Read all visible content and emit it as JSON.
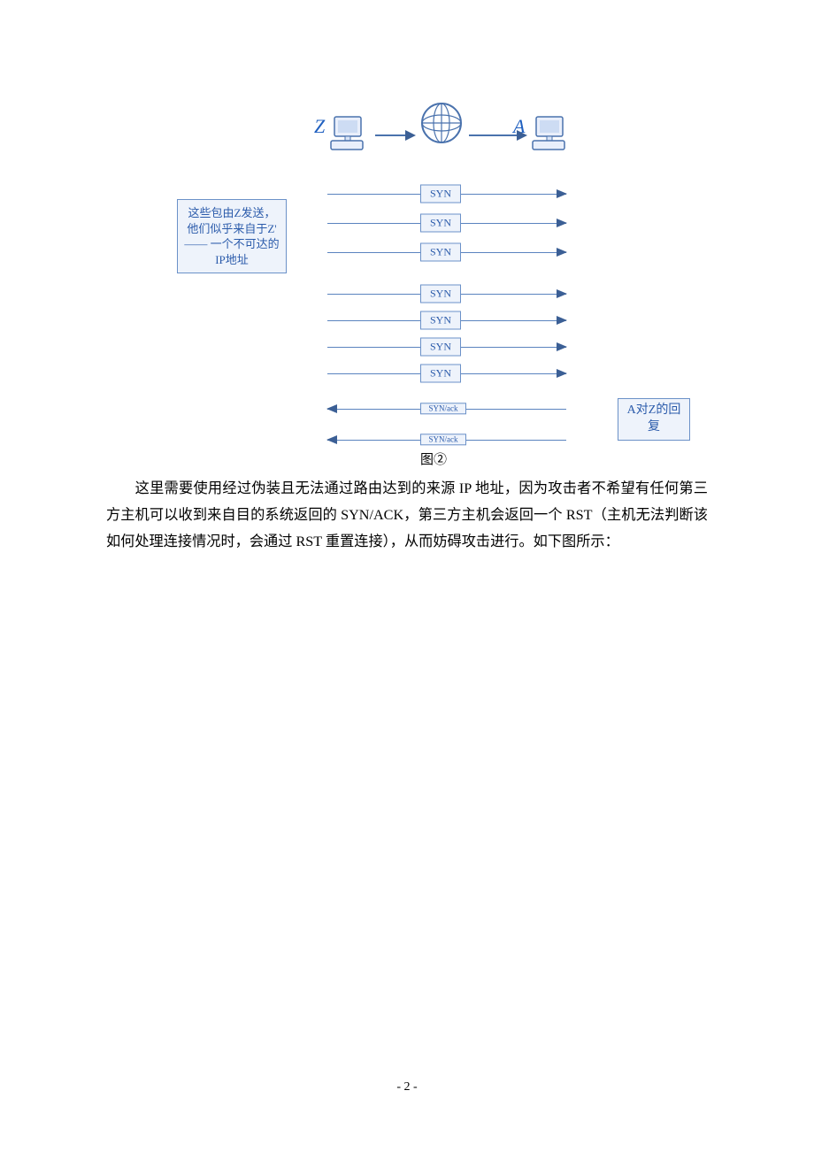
{
  "diagram": {
    "z_label": "Z",
    "a_label": "A",
    "note_left": "这些包由Z发送，他们似乎来自于Z' —— 一个不可达的IP地址",
    "note_right": "A对Z的回复",
    "syn_rows": [
      "SYN",
      "SYN",
      "SYN",
      "SYN",
      "SYN",
      "SYN",
      "SYN"
    ],
    "ack_rows": [
      "SYN/ack",
      "SYN/ack"
    ],
    "caption": "图②"
  },
  "paragraph": "这里需要使用经过伪装且无法通过路由达到的来源 IP 地址，因为攻击者不希望有任何第三方主机可以收到来自目的系统返回的 SYN/ACK，第三方主机会返回一个 RST（主机无法判断该如何处理连接情况时，会通过 RST 重置连接），从而妨碍攻击进行。如下图所示：",
  "page_number": "- 2 -"
}
